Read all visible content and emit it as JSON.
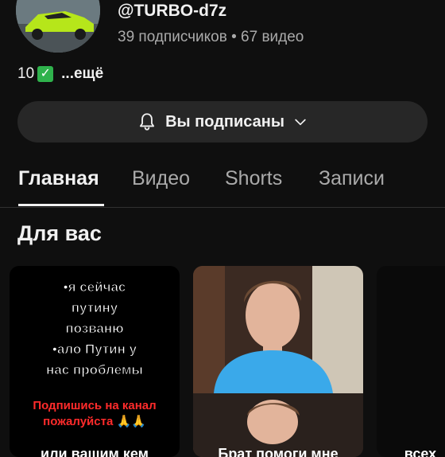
{
  "channel": {
    "handle": "@TURBO-d7z",
    "stats": "39 подписчиков • 67 видео",
    "description_prefix": "10",
    "description_more": "...ещё"
  },
  "subscribe": {
    "label": "Вы подписаны"
  },
  "tabs": [
    {
      "label": "Главная",
      "active": true
    },
    {
      "label": "Видео",
      "active": false
    },
    {
      "label": "Shorts",
      "active": false
    },
    {
      "label": "Записи",
      "active": false
    }
  ],
  "section": {
    "title": "Для вас"
  },
  "cards": [
    {
      "overlay_lines": [
        "•я сейчас",
        "путину",
        "позваню",
        "•ало Путин у",
        "нас проблемы"
      ],
      "subscribe_call_line1": "Подпишись на канал",
      "subscribe_call_line2": "пожалуйста 🙏🙏",
      "bottom_text": "или вашим кем"
    },
    {
      "bottom_text": "Брат помоги мне"
    },
    {
      "bottom_text": "всех"
    }
  ],
  "colors": {
    "background": "#0f0f0f",
    "button_bg": "#272727",
    "accent_text": "#f1f1f1",
    "secondary_text": "#aaaaaa",
    "subscribe_call": "#ff2b2b"
  },
  "icons": {
    "subscribe_bell": "bell-icon",
    "subscribe_chevron": "chevron-down-icon",
    "description_check": "check-mark-icon"
  }
}
